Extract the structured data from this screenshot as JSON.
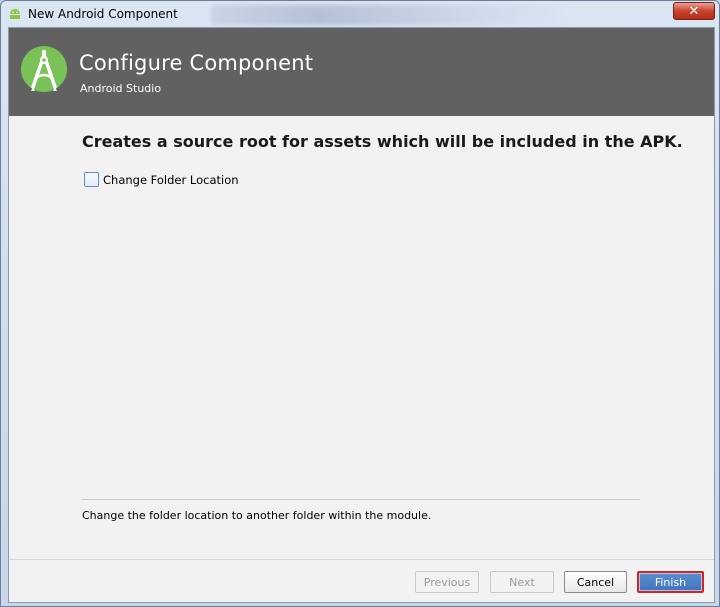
{
  "window": {
    "title": "New Android Component",
    "close_label": "✕"
  },
  "header": {
    "title": "Configure Component",
    "subtitle": "Android Studio"
  },
  "main": {
    "heading": "Creates a source root for assets which will be included in the APK.",
    "checkbox_label": "Change Folder Location",
    "checkbox_checked": false,
    "description": "Change the folder location to another folder within the module."
  },
  "footer": {
    "previous_label": "Previous",
    "next_label": "Next",
    "cancel_label": "Cancel",
    "finish_label": "Finish"
  },
  "icons": {
    "title_icon": "android-icon",
    "header_logo": "android-studio-logo-icon"
  },
  "colors": {
    "header_bg": "#616161",
    "logo_green": "#78c257",
    "finish_bg": "#4a80c6",
    "finish_border": "#d2242b"
  }
}
